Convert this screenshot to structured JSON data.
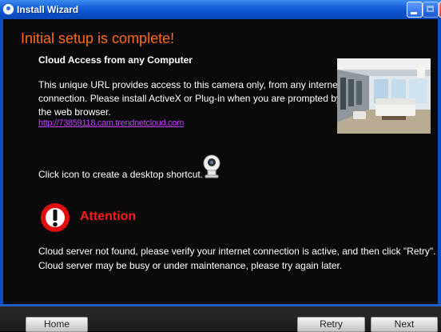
{
  "window": {
    "title": "Install Wizard"
  },
  "main": {
    "heading": "Initial setup is complete!",
    "subheading": "Cloud Access from any Computer",
    "description_lines": [
      "This unique URL provides access to this camera only, from any internet",
      "connection. Please install ActiveX or Plug-in when you are prompted by",
      "the web browser."
    ],
    "url": "http://73859118.cam.trendnetcloud.com",
    "shortcut_text": "Click icon to create a desktop shortcut.",
    "attention_label": "Attention",
    "message_lines": [
      "Cloud server not found, please verify your internet connection is active, and then click \"Retry\".",
      "Cloud server may be busy or under maintenance, please try again later."
    ]
  },
  "footer": {
    "home_label": "Home",
    "retry_label": "Retry",
    "next_label": "Next"
  },
  "colors": {
    "heading": "#ff6a1a",
    "attention": "#ff1a1a",
    "link": "#c040ff",
    "titlebar": "#0a4ec8"
  },
  "icons": {
    "title": "wizard-icon",
    "shortcut": "ip-camera-icon",
    "attention": "exclamation-icon"
  }
}
